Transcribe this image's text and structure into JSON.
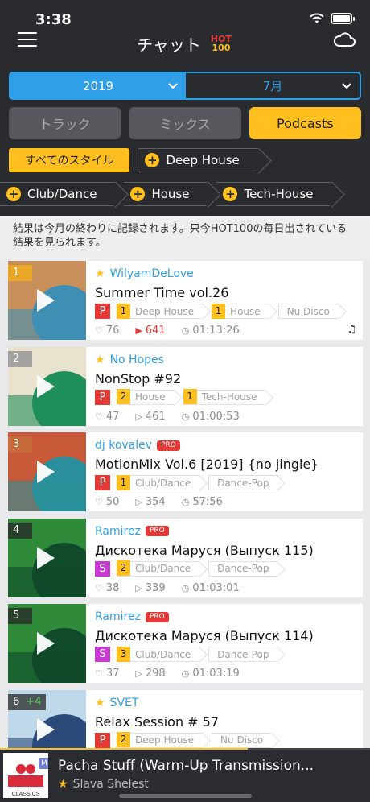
{
  "status_bar": {
    "time": "3:38"
  },
  "header": {
    "title": "チャット",
    "hot_logo_top": "HOT",
    "hot_logo_bottom": "100"
  },
  "filters": {
    "year": "2019",
    "month": "7月",
    "tabs": [
      {
        "label": "トラック",
        "active": false
      },
      {
        "label": "ミックス",
        "active": false
      },
      {
        "label": "Podcasts",
        "active": true
      }
    ],
    "all_styles": "すべてのスタイル",
    "styles": [
      "Deep House",
      "Club/Dance",
      "House",
      "Tech-House"
    ]
  },
  "notice": "結果は今月の終わりに記録されます。只今HOT100の毎日出されている結果を見られます。",
  "items": [
    {
      "rank": "1",
      "rank_change": "",
      "author": "WilyamDeLove",
      "starred": true,
      "pro": false,
      "title": "Summer Time vol.26",
      "type": "P",
      "genres": [
        {
          "level": "1",
          "name": "Deep House"
        },
        {
          "level": "1",
          "name": "House"
        },
        {
          "level": "",
          "name": "Nu Disco"
        }
      ],
      "likes": "76",
      "plays": "641",
      "plays_hot": true,
      "duration": "01:13:26",
      "art_colors": [
        "#c98f5a",
        "#3f8fb5"
      ]
    },
    {
      "rank": "2",
      "rank_change": "",
      "author": "No Hopes",
      "starred": true,
      "pro": false,
      "title": "NonStop #92",
      "type": "P",
      "genres": [
        {
          "level": "2",
          "name": "House"
        },
        {
          "level": "1",
          "name": "Tech-House"
        }
      ],
      "likes": "47",
      "plays": "461",
      "plays_hot": false,
      "duration": "01:00:53",
      "art_colors": [
        "#e9e2cf",
        "#1f8f5a"
      ]
    },
    {
      "rank": "3",
      "rank_change": "",
      "author": "dj kovalev",
      "starred": false,
      "pro": true,
      "title": "MotionMix Vol.6 [2019] {no jingle}",
      "type": "P",
      "genres": [
        {
          "level": "1",
          "name": "Club/Dance"
        },
        {
          "level": "",
          "name": "Dance-Pop"
        }
      ],
      "likes": "50",
      "plays": "354",
      "plays_hot": false,
      "duration": "57:56",
      "art_colors": [
        "#c85a3a",
        "#2a8f9a"
      ]
    },
    {
      "rank": "4",
      "rank_change": "",
      "author": "Ramirez",
      "starred": false,
      "pro": true,
      "title": "Дискотека Маруся (Выпуск 115)",
      "type": "S",
      "genres": [
        {
          "level": "2",
          "name": "Club/Dance"
        },
        {
          "level": "",
          "name": "Dance-Pop"
        }
      ],
      "likes": "38",
      "plays": "339",
      "plays_hot": false,
      "duration": "01:03:01",
      "art_colors": [
        "#2f8a3a",
        "#0f4a2a"
      ]
    },
    {
      "rank": "5",
      "rank_change": "",
      "author": "Ramirez",
      "starred": false,
      "pro": true,
      "title": "Дискотека Маруся (Выпуск 114)",
      "type": "S",
      "genres": [
        {
          "level": "3",
          "name": "Club/Dance"
        },
        {
          "level": "",
          "name": "Dance-Pop"
        }
      ],
      "likes": "37",
      "plays": "298",
      "plays_hot": false,
      "duration": "01:03:19",
      "art_colors": [
        "#2f8a3a",
        "#0f4a2a"
      ]
    },
    {
      "rank": "6",
      "rank_change": "+4",
      "author": "SVET",
      "starred": true,
      "pro": false,
      "title": "Relax Session # 57",
      "type": "P",
      "genres": [
        {
          "level": "2",
          "name": "Deep House"
        },
        {
          "level": "",
          "name": "Nu Disco"
        }
      ],
      "likes": "",
      "plays": "",
      "plays_hot": false,
      "duration": "",
      "art_colors": [
        "#bfd9ea",
        "#2b4a7a"
      ]
    }
  ],
  "player": {
    "title": "Pacha Stuff (Warm-Up Transmission...",
    "artist": "Slava Shelest",
    "badge": "M",
    "art_text": "CLASSICS",
    "progress": 0.67
  },
  "colors": {
    "accent": "#ffc01f",
    "blue": "#2f9fe8",
    "red": "#e53935",
    "header_bg": "#2a2b2f"
  }
}
